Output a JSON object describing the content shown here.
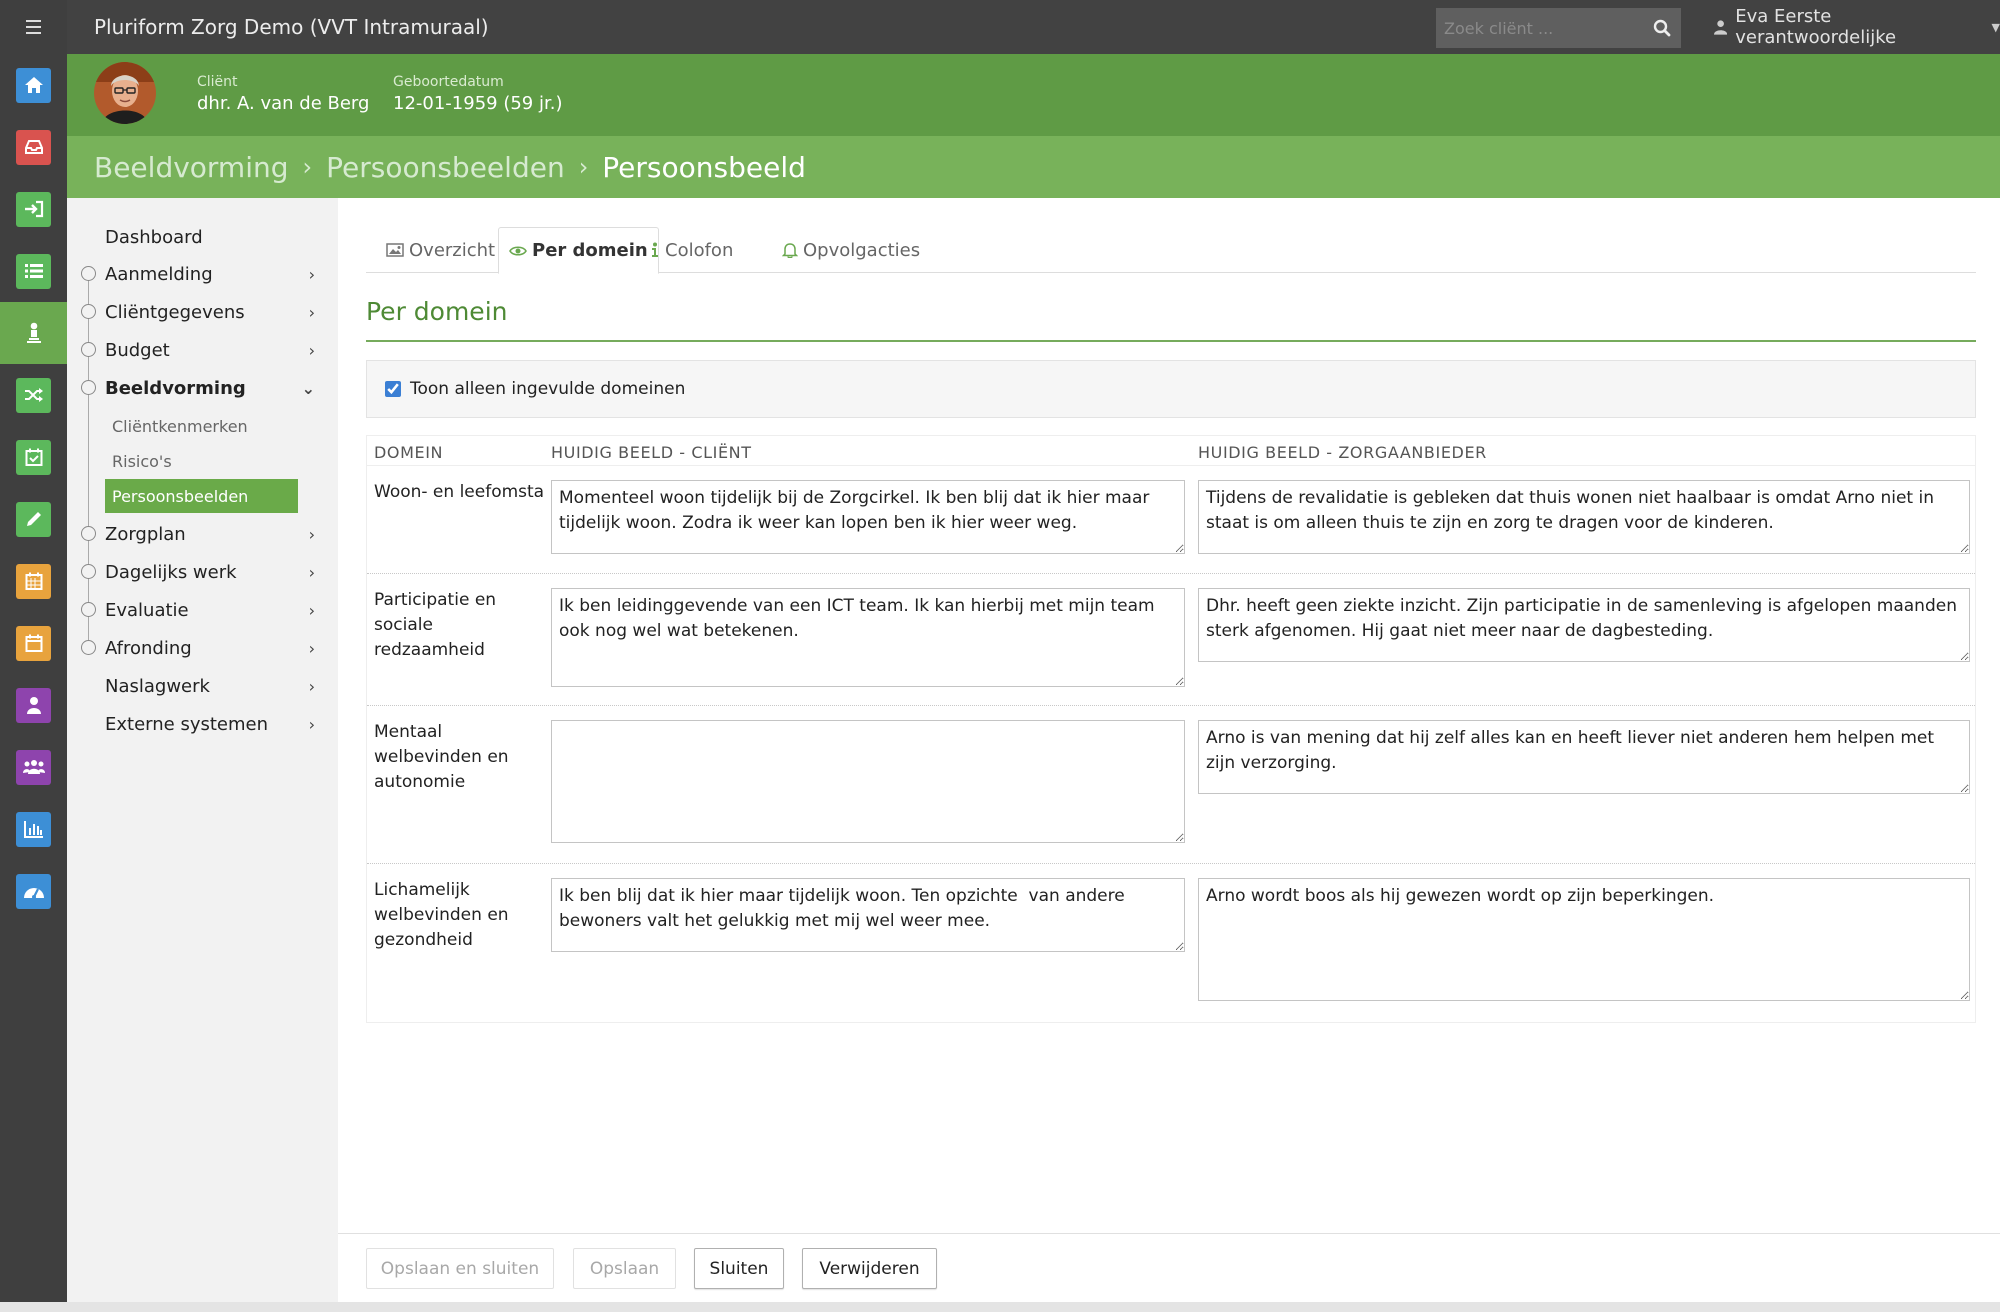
{
  "topbar": {
    "title": "Pluriform Zorg Demo  (VVT Intramuraal)",
    "search_placeholder": "Zoek cliënt ...",
    "user_name": "Eva Eerste verantwoordelijke"
  },
  "client": {
    "name_label": "Cliënt",
    "name": "dhr. A. van de Berg",
    "dob_label": "Geboortedatum",
    "dob": "12-01-1959 (59 jr.)"
  },
  "breadcrumb": [
    "Beeldvorming",
    "Persoonsbeelden",
    "Persoonsbeeld"
  ],
  "rail": [
    {
      "icon": "home-icon",
      "color": "#3d8fd6"
    },
    {
      "icon": "inbox-icon",
      "color": "#d9534f"
    },
    {
      "icon": "sign-in-icon",
      "color": "#5cb85c"
    },
    {
      "icon": "list-icon",
      "color": "#5cb85c"
    },
    {
      "icon": "client-icon",
      "color": "#6aa84f"
    },
    {
      "icon": "shuffle-icon",
      "color": "#5cb85c"
    },
    {
      "icon": "calendar-check-icon",
      "color": "#5cb85c"
    },
    {
      "icon": "pencil-icon",
      "color": "#5cb85c"
    },
    {
      "icon": "calendar-grid-icon",
      "color": "#e8a33d"
    },
    {
      "icon": "calendar-icon",
      "color": "#e8a33d"
    },
    {
      "icon": "user-icon",
      "color": "#8e44ad"
    },
    {
      "icon": "users-icon",
      "color": "#8e44ad"
    },
    {
      "icon": "bar-chart-icon",
      "color": "#3d8fd6"
    },
    {
      "icon": "dashboard-icon",
      "color": "#3d8fd6"
    }
  ],
  "sidebar": {
    "items": [
      {
        "label": "Dashboard"
      },
      {
        "label": "Aanmelding"
      },
      {
        "label": "Cliëntgegevens"
      },
      {
        "label": "Budget"
      },
      {
        "label": "Beeldvorming"
      },
      {
        "label": "Zorgplan"
      },
      {
        "label": "Dagelijks werk"
      },
      {
        "label": "Evaluatie"
      },
      {
        "label": "Afronding"
      },
      {
        "label": "Naslagwerk"
      },
      {
        "label": "Externe systemen"
      }
    ],
    "subitems": [
      {
        "label": "Cliëntkenmerken"
      },
      {
        "label": "Risico's"
      },
      {
        "label": "Persoonsbeelden"
      }
    ]
  },
  "tabs": [
    "Overzicht",
    "Per domein",
    "Colofon",
    "Opvolgacties"
  ],
  "section_title": "Per domein",
  "filter": {
    "label": "Toon alleen ingevulde domeinen",
    "checked": true
  },
  "table": {
    "headers": [
      "DOMEIN",
      "HUIDIG BEELD - CLIËNT",
      "HUIDIG BEELD - ZORGAANBIEDER"
    ],
    "rows": [
      {
        "domain": "Woon- en leefomstandigheden",
        "client": "Momenteel woon tijdelijk bij de Zorgcirkel. Ik ben blij dat ik hier maar tijdelijk woon. Zodra ik weer kan lopen ben ik hier weer weg.",
        "provider": "Tijdens de revalidatie is gebleken dat thuis wonen niet haalbaar is omdat Arno niet in staat is om alleen thuis te zijn en zorg te dragen voor de kinderen."
      },
      {
        "domain": "Participatie en sociale redzaamheid",
        "client": "Ik ben leidinggevende van een ICT team. Ik kan hierbij met mijn team ook nog wel wat betekenen.",
        "provider": "Dhr. heeft geen ziekte inzicht. Zijn participatie in de samenleving is afgelopen maanden sterk afgenomen. Hij gaat niet meer naar de dagbesteding."
      },
      {
        "domain": "Mentaal welbevinden en autonomie",
        "client": "",
        "provider": "Arno is van mening dat hij zelf alles kan en heeft liever niet anderen hem helpen met zijn verzorging."
      },
      {
        "domain": "Lichamelijk welbevinden en gezondheid",
        "client": "Ik ben blij dat ik hier maar tijdelijk woon. Ten opzichte  van andere bewoners valt het gelukkig met mij wel weer mee.",
        "provider": "Arno wordt boos als hij gewezen wordt op zijn beperkingen."
      }
    ]
  },
  "footer": {
    "save_close": "Opslaan en sluiten",
    "save": "Opslaan",
    "close": "Sluiten",
    "delete": "Verwijderen"
  },
  "colors": {
    "topbar": "#424242",
    "client_header": "#5f9b45",
    "breadcrumb": "#78b25a",
    "accent": "#4e8a35"
  }
}
